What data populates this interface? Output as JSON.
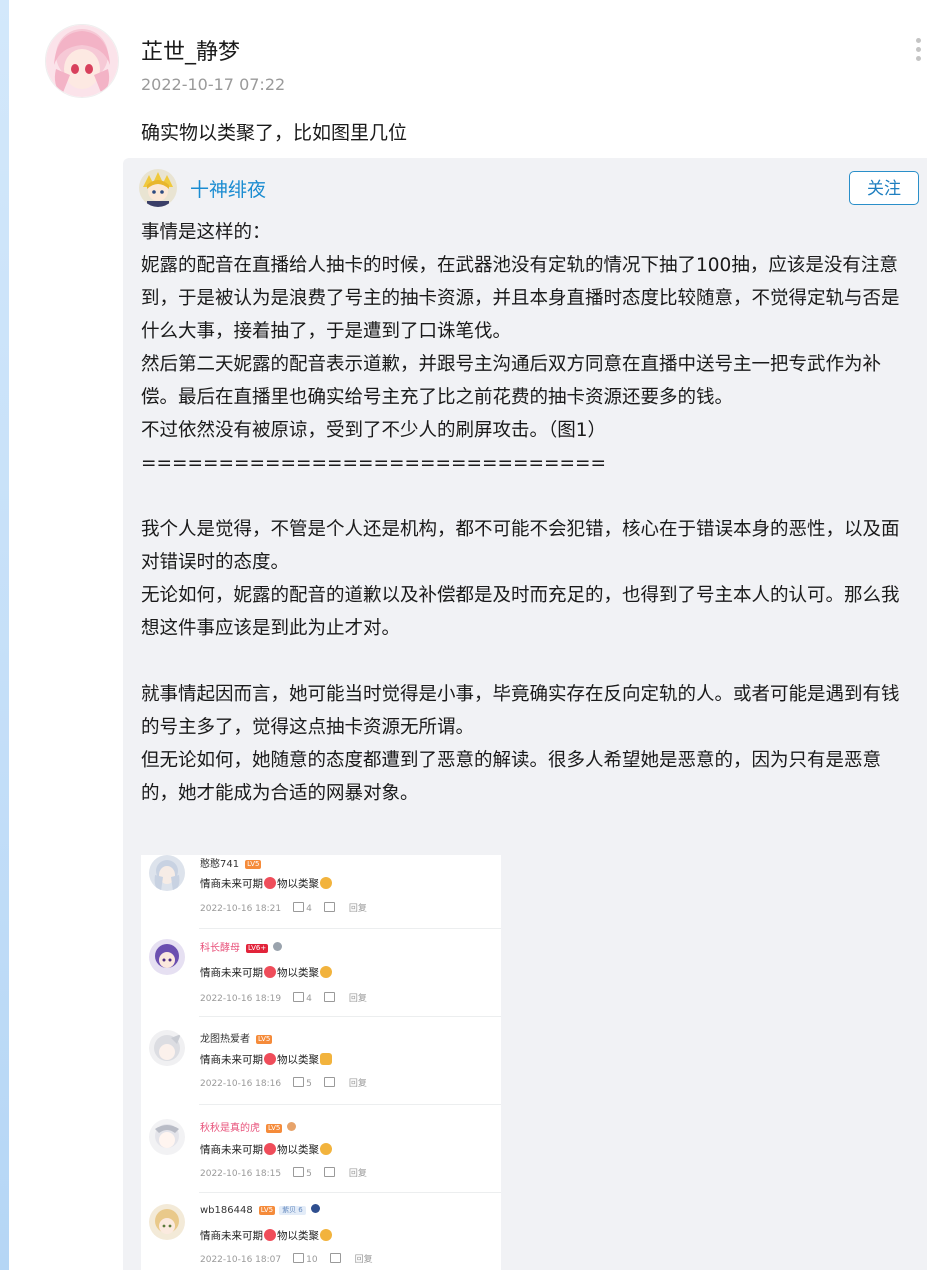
{
  "post": {
    "username": "芷世_静梦",
    "timestamp": "2022-10-17 07:22",
    "comment": "确实物以类聚了，比如图里几位"
  },
  "repost": {
    "author": "十神绯夜",
    "follow_label": "关注",
    "body": "事情是这样的：\n妮露的配音在直播给人抽卡的时候，在武器池没有定轨的情况下抽了100抽，应该是没有注意到，于是被认为是浪费了号主的抽卡资源，并且本身直播时态度比较随意，不觉得定轨与否是什么大事，接着抽了，于是遭到了口诛笔伐。\n然后第二天妮露的配音表示道歉，并跟号主沟通后双方同意在直播中送号主一把专武作为补偿。最后在直播里也确实给号主充了比之前花费的抽卡资源还要多的钱。\n不过依然没有被原谅，受到了不少人的刷屏攻击。（图1）\n==============================\n\n我个人是觉得，不管是个人还是机构，都不可能不会犯错，核心在于错误本身的恶性，以及面对错误时的态度。\n无论如何，妮露的配音的道歉以及补偿都是及时而充足的，也得到了号主本人的认可。那么我想这件事应该是到此为止才对。\n\n就事情起因而言，她可能当时觉得是小事，毕竟确实存在反向定轨的人。或者可能是遇到有钱的号主多了，觉得这点抽卡资源无所谓。\n但无论如何，她随意的态度都遭到了恶意的解读。很多人希望她是恶意的，因为只有是恶意的，她才能成为合适的网暴对象。"
  },
  "screenshot": {
    "reply_label": "回复",
    "comments": [
      {
        "name": "憨憨741",
        "level": "LV5",
        "fan": "",
        "text_a": "情商未来可期",
        "text_b": "物以类聚",
        "time": "2022-10-16 18:21",
        "likes": "4"
      },
      {
        "name": "科长酵母",
        "level": "LV6+",
        "fan": "",
        "text_a": "情商未来可期",
        "text_b": "物以类聚",
        "time": "2022-10-16 18:19",
        "likes": "4"
      },
      {
        "name": "龙图热爱者",
        "level": "LV5",
        "fan": "",
        "text_a": "情商未来可期",
        "text_b": "物以类聚",
        "time": "2022-10-16 18:16",
        "likes": "5"
      },
      {
        "name": "秋秋是真的虎",
        "level": "LV5",
        "fan": "",
        "text_a": "情商未来可期",
        "text_b": "物以类聚",
        "time": "2022-10-16 18:15",
        "likes": "5"
      },
      {
        "name": "wb186448",
        "level": "LV5",
        "fan": "紫贝 6",
        "text_a": "情商未来可期",
        "text_b": "物以类聚",
        "time": "2022-10-16 18:07",
        "likes": "10"
      }
    ]
  },
  "colors": {
    "link_blue": "#1a8cd1",
    "repost_bg": "#f1f2f5",
    "meta_gray": "#9a9a9a"
  }
}
